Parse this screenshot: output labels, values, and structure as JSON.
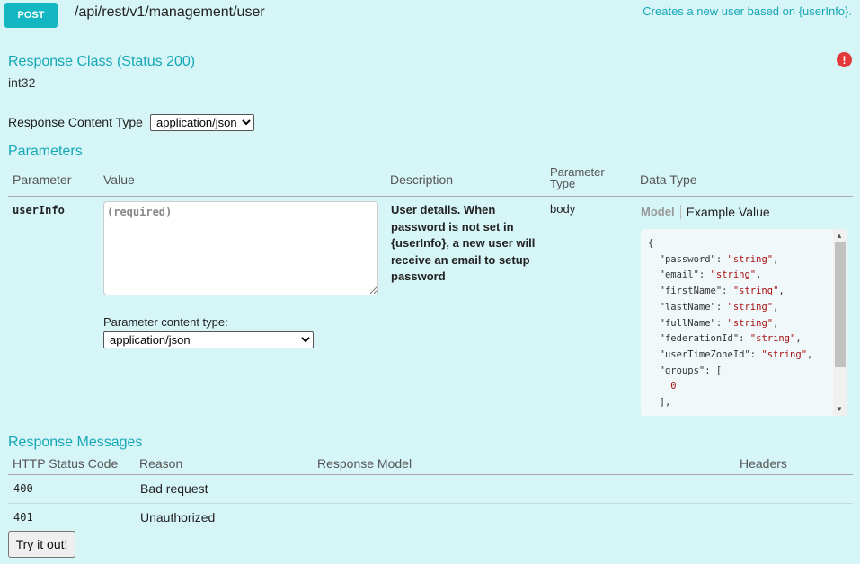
{
  "operation": {
    "method": "POST",
    "path": "/api/rest/v1/management/user",
    "summary": "Creates a new user based on {userInfo}.",
    "error_icon": "error-circle-icon"
  },
  "response_class": {
    "title": "Response Class (Status 200)",
    "type": "int32"
  },
  "response_content_type": {
    "label": "Response Content Type",
    "selected": "application/json"
  },
  "parameters": {
    "title": "Parameters",
    "headers": {
      "parameter": "Parameter",
      "value": "Value",
      "description": "Description",
      "parameter_type_line1": "Parameter",
      "parameter_type_line2": "Type",
      "data_type": "Data Type"
    },
    "rows": [
      {
        "name": "userInfo",
        "placeholder": "(required)",
        "description": "User details. When password is not set in {userInfo}, a new user will receive an email to setup password",
        "param_type": "body",
        "content_type_label": "Parameter content type:",
        "content_type": "application/json",
        "tab_model": "Model",
        "tab_example": "Example Value",
        "example_lines": [
          "{",
          "  \"password\": \"string\",",
          "  \"email\": \"string\",",
          "  \"firstName\": \"string\",",
          "  \"lastName\": \"string\",",
          "  \"fullName\": \"string\",",
          "  \"federationId\": \"string\",",
          "  \"userTimeZoneId\": \"string\",",
          "  \"groups\": [",
          "    0",
          "  ],"
        ]
      }
    ]
  },
  "response_messages": {
    "title": "Response Messages",
    "headers": {
      "status_code": "HTTP Status Code",
      "reason": "Reason",
      "model": "Response Model",
      "headers": "Headers"
    },
    "rows": [
      {
        "code": "400",
        "reason": "Bad request"
      },
      {
        "code": "401",
        "reason": "Unauthorized"
      }
    ]
  },
  "try_button": "Try it out!"
}
